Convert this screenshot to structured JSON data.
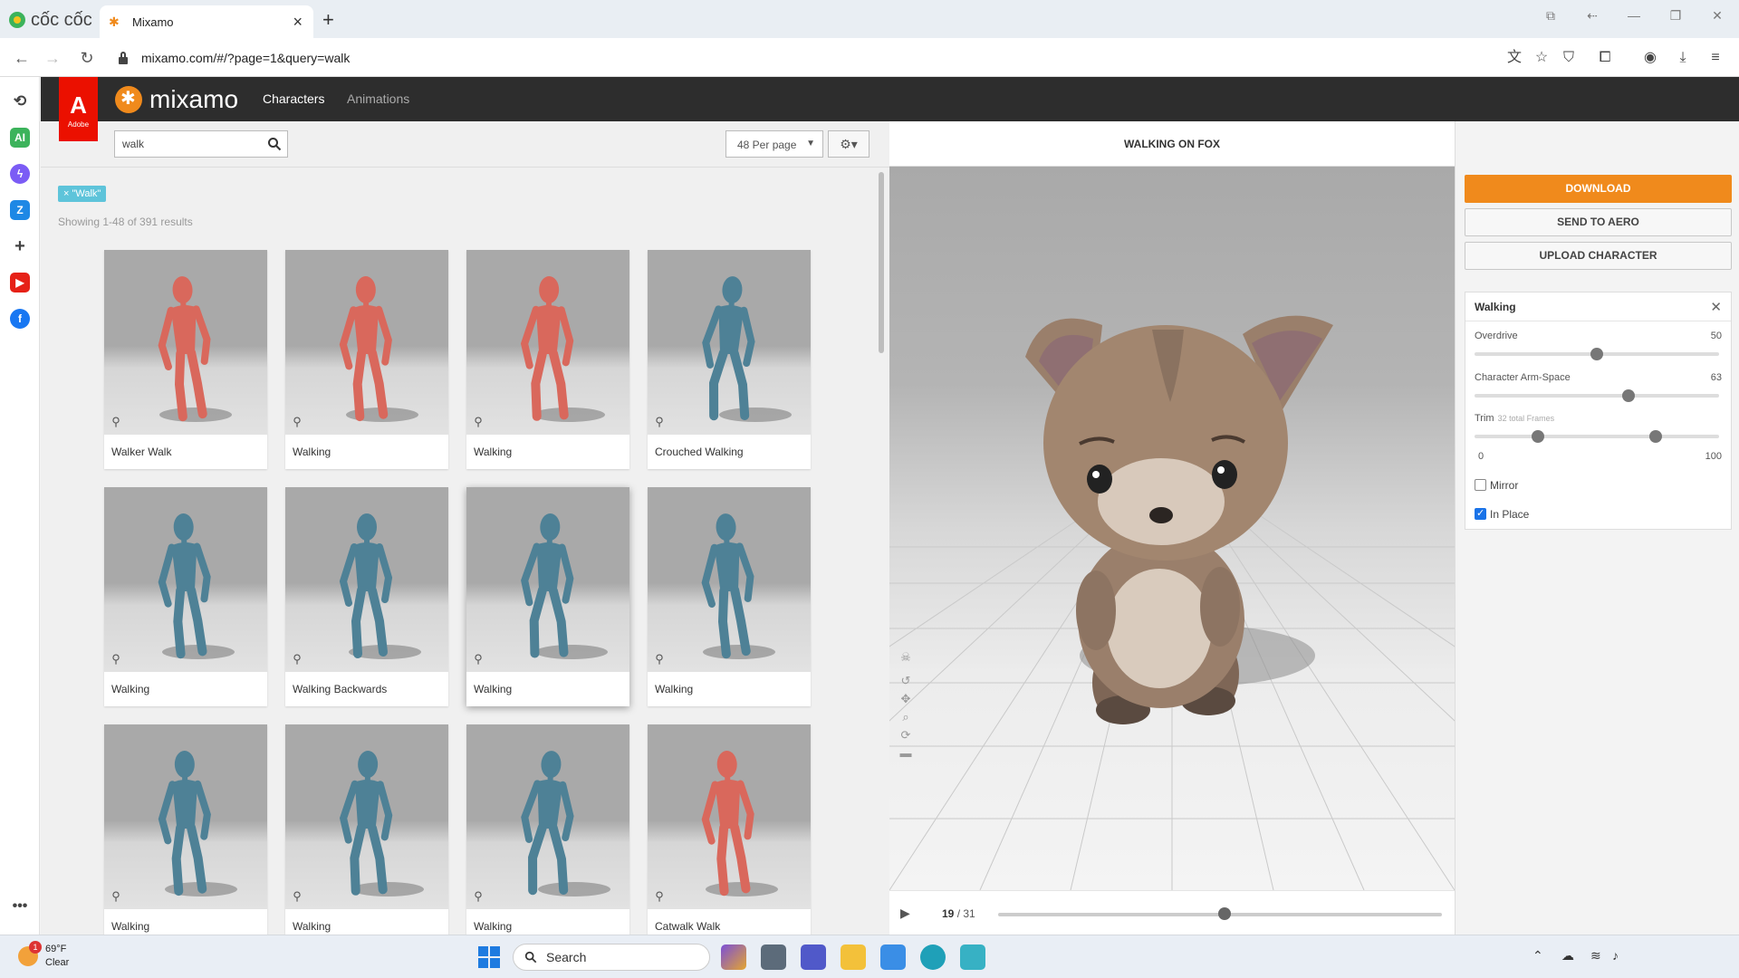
{
  "browser": {
    "brand": "cốc cốc",
    "tab_title": "Mixamo",
    "url": "mixamo.com/#/?page=1&query=walk"
  },
  "mixamo": {
    "adobe_logo": "Adobe",
    "logo_text": "mixamo",
    "nav": [
      "Characters",
      "Animations"
    ],
    "search_value": "walk",
    "per_page": "48 Per page",
    "filter_tag": "× \"Walk\"",
    "results_text": "Showing 1-48 of 391 results",
    "cards": [
      {
        "label": "Walker Walk",
        "model": "red"
      },
      {
        "label": "Walking",
        "model": "red"
      },
      {
        "label": "Walking",
        "model": "red"
      },
      {
        "label": "Crouched Walking",
        "model": "blue"
      },
      {
        "label": "Walking",
        "model": "blue"
      },
      {
        "label": "Walking Backwards",
        "model": "blue"
      },
      {
        "label": "Walking",
        "model": "blue",
        "selected": true
      },
      {
        "label": "Walking",
        "model": "blue"
      },
      {
        "label": "Walking",
        "model": "blue"
      },
      {
        "label": "Walking",
        "model": "blue"
      },
      {
        "label": "Walking",
        "model": "blue"
      },
      {
        "label": "Catwalk Walk",
        "model": "red"
      }
    ],
    "preview_title": "WALKING ON FOX",
    "frame_current": "19",
    "frame_total": "/ 31",
    "playback_fraction": 0.51,
    "buttons": {
      "download": "DOWNLOAD",
      "send": "SEND TO AERO",
      "upload": "UPLOAD CHARACTER"
    },
    "settings": {
      "title": "Walking",
      "overdrive_label": "Overdrive",
      "overdrive_value": "50",
      "overdrive_fraction": 0.5,
      "armspace_label": "Character Arm-Space",
      "armspace_value": "63",
      "armspace_fraction": 0.63,
      "trim_label": "Trim",
      "trim_sub": "32 total Frames",
      "trim_min": "0",
      "trim_max": "100",
      "trim_start_fraction": 0.26,
      "trim_end_fraction": 0.74,
      "mirror_label": "Mirror",
      "mirror_checked": false,
      "inplace_label": "In Place",
      "inplace_checked": true
    }
  },
  "taskbar": {
    "temp": "69°F",
    "condition": "Clear",
    "badge": "1",
    "search": "Search"
  },
  "colors": {
    "accent": "#f08a1c",
    "adobe_red": "#eb1000",
    "header_bg": "#2d2d2d",
    "tag_bg": "#5ec4da",
    "red_model": "#d9685c",
    "blue_model": "#4e8196"
  }
}
